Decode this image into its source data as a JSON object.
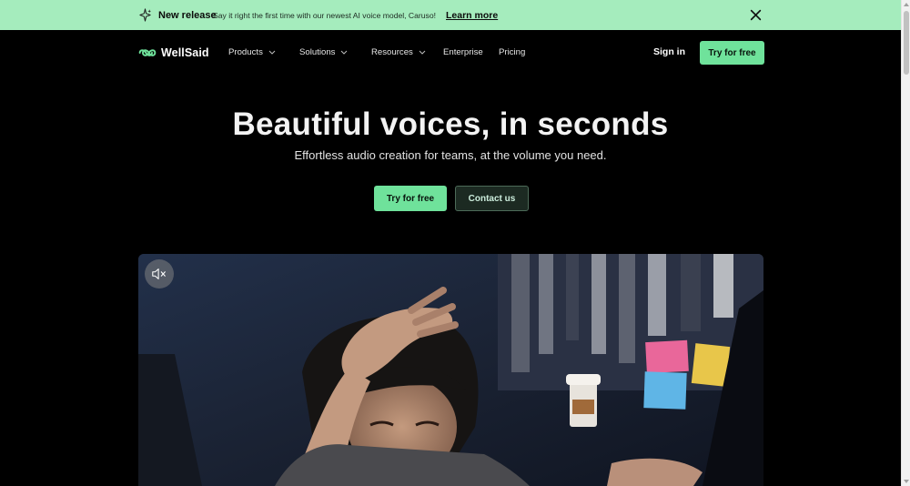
{
  "announcement": {
    "badge_label": "New release",
    "message": "Say it right the first time with our newest AI voice model, Caruso!",
    "link_label": "Learn more",
    "icons": {
      "leading": "sparkle-icon",
      "close": "close-icon"
    },
    "background": "#a5ecbd"
  },
  "nav": {
    "brand": "WellSaid",
    "items": [
      {
        "label": "Products",
        "has_dropdown": true
      },
      {
        "label": "Solutions",
        "has_dropdown": true
      },
      {
        "label": "Resources",
        "has_dropdown": true
      },
      {
        "label": "Enterprise",
        "has_dropdown": false
      },
      {
        "label": "Pricing",
        "has_dropdown": false
      }
    ],
    "sign_in_label": "Sign in",
    "cta_label": "Try for free"
  },
  "hero": {
    "title": "Beautiful voices, in seconds",
    "subtitle": "Effortless audio creation for teams, at the volume you need.",
    "primary_cta": "Try for free",
    "secondary_cta": "Contact us"
  },
  "video": {
    "mute_icon": "speaker-muted-icon"
  },
  "colors": {
    "accent": "#6fe29b",
    "page_background": "#000000",
    "secondary_button_bg": "#1c2a22"
  }
}
